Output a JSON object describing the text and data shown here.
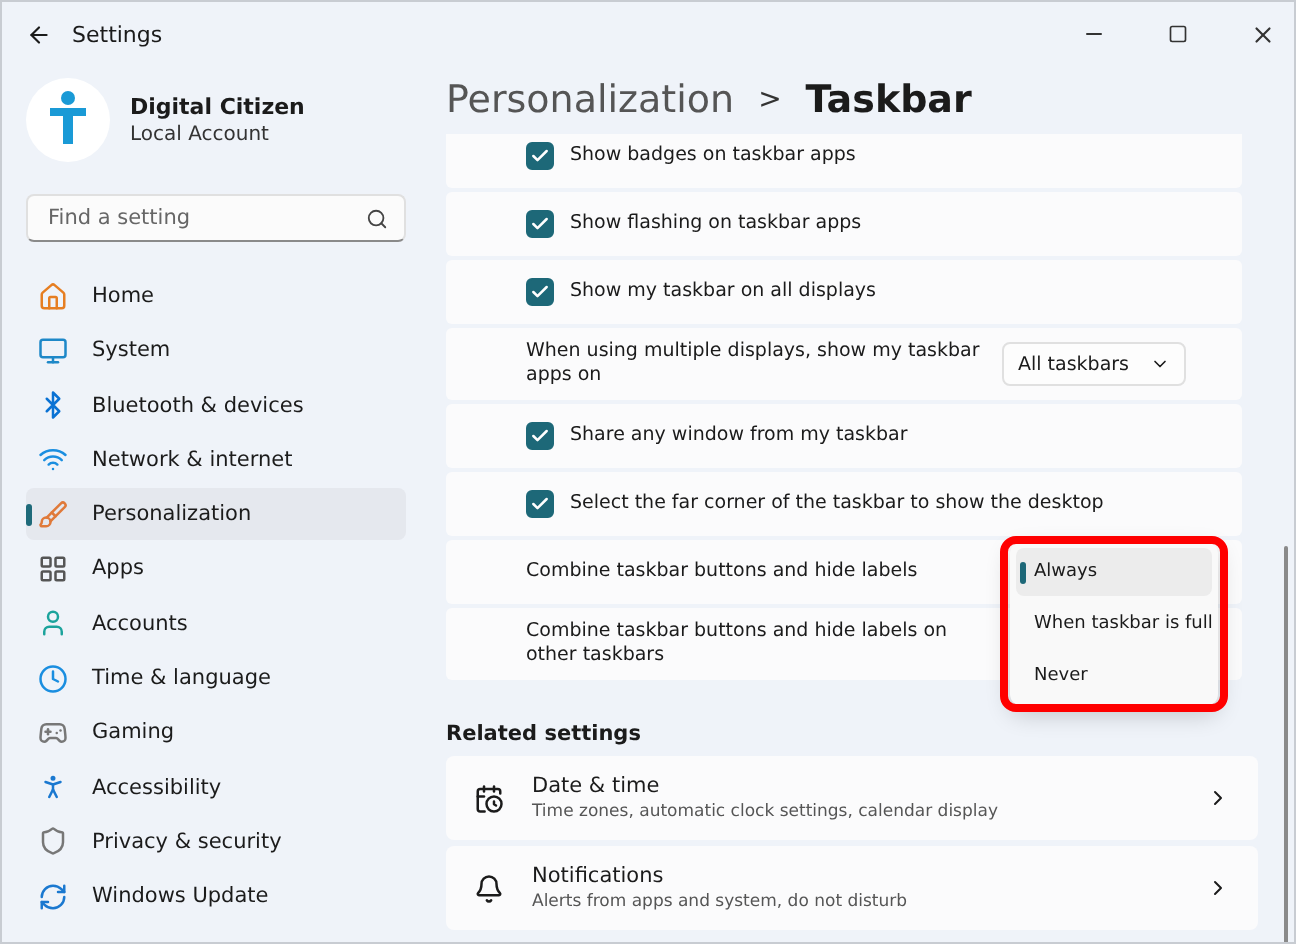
{
  "window": {
    "title": "Settings"
  },
  "profile": {
    "name": "Digital Citizen",
    "account": "Local Account"
  },
  "search": {
    "placeholder": "Find a setting"
  },
  "nav": [
    {
      "label": "Home",
      "selected": false
    },
    {
      "label": "System",
      "selected": false
    },
    {
      "label": "Bluetooth & devices",
      "selected": false
    },
    {
      "label": "Network & internet",
      "selected": false
    },
    {
      "label": "Personalization",
      "selected": true
    },
    {
      "label": "Apps",
      "selected": false
    },
    {
      "label": "Accounts",
      "selected": false
    },
    {
      "label": "Time & language",
      "selected": false
    },
    {
      "label": "Gaming",
      "selected": false
    },
    {
      "label": "Accessibility",
      "selected": false
    },
    {
      "label": "Privacy & security",
      "selected": false
    },
    {
      "label": "Windows Update",
      "selected": false
    }
  ],
  "breadcrumb": {
    "parent": "Personalization",
    "separator": ">",
    "current": "Taskbar"
  },
  "settings": [
    {
      "kind": "checkbox",
      "label": "Show badges on taskbar apps",
      "checked": true
    },
    {
      "kind": "checkbox",
      "label": "Show flashing on taskbar apps",
      "checked": true
    },
    {
      "kind": "checkbox",
      "label": "Show my taskbar on all displays",
      "checked": true
    },
    {
      "kind": "dropdown",
      "label": "When using multiple displays, show my taskbar apps on",
      "value": "All taskbars"
    },
    {
      "kind": "checkbox",
      "label": "Share any window from my taskbar",
      "checked": true
    },
    {
      "kind": "checkbox",
      "label": "Select the far corner of the taskbar to show the desktop",
      "checked": true
    },
    {
      "kind": "menu",
      "label": "Combine taskbar buttons and hide labels",
      "options": [
        {
          "label": "Always",
          "selected": true
        },
        {
          "label": "When taskbar is full",
          "selected": false
        },
        {
          "label": "Never",
          "selected": false
        }
      ]
    },
    {
      "kind": "plain",
      "label": "Combine taskbar buttons and hide labels on other taskbars"
    }
  ],
  "related": {
    "heading": "Related settings",
    "items": [
      {
        "title": "Date & time",
        "subtitle": "Time zones, automatic clock settings, calendar display"
      },
      {
        "title": "Notifications",
        "subtitle": "Alerts from apps and system, do not disturb"
      }
    ]
  }
}
